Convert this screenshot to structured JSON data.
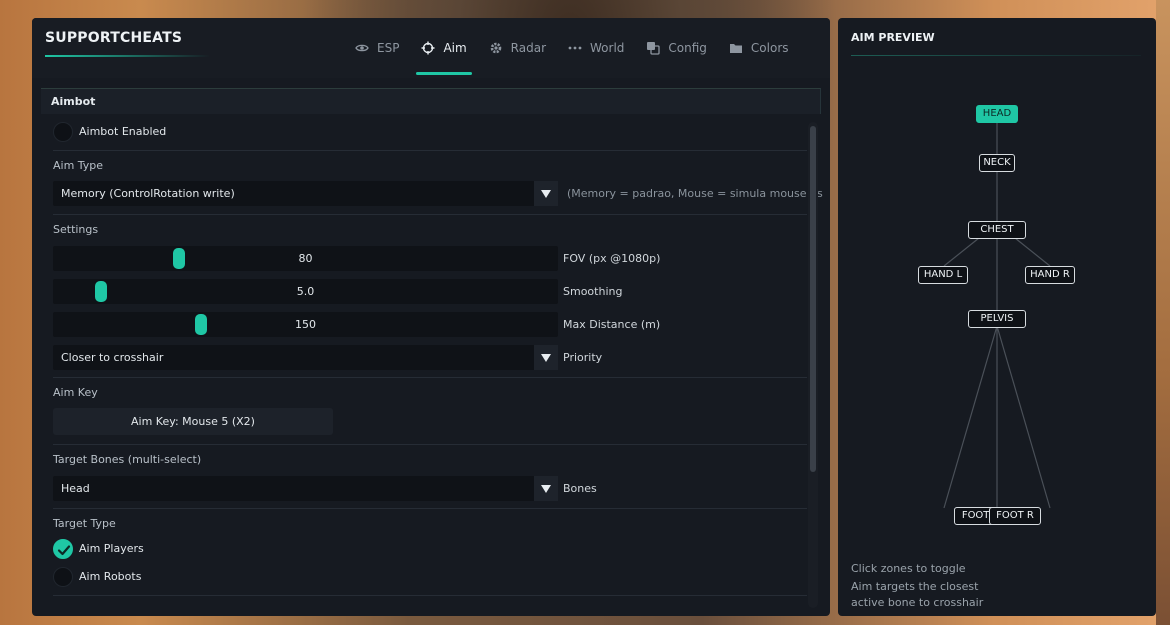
{
  "header": {
    "brand": "SUPPORTCHEATS",
    "tabs": [
      {
        "label": "ESP",
        "icon": "eye-icon",
        "active": false
      },
      {
        "label": "Aim",
        "icon": "crosshair-icon",
        "active": true
      },
      {
        "label": "Radar",
        "icon": "gear-icon",
        "active": false
      },
      {
        "label": "World",
        "icon": "dots-icon",
        "active": false
      },
      {
        "label": "Config",
        "icon": "copy-icon",
        "active": false
      },
      {
        "label": "Colors",
        "icon": "folder-icon",
        "active": false
      }
    ]
  },
  "aimbot": {
    "section_title": "Aimbot",
    "enabled_label": "Aimbot Enabled",
    "enabled": false,
    "aim_type_label": "Aim Type",
    "aim_type_value": "Memory (ControlRotation write)",
    "aim_type_hint": "(Memory = padrao, Mouse = simula mouse fis",
    "settings_label": "Settings",
    "sliders": [
      {
        "value": "80",
        "label": "FOV (px @1080p)",
        "fraction": 0.25
      },
      {
        "value": "5.0",
        "label": "Smoothing",
        "fraction": 0.095
      },
      {
        "value": "150",
        "label": "Max Distance (m)",
        "fraction": 0.293
      }
    ],
    "priority_value": "Closer to crosshair",
    "priority_label": "Priority",
    "aim_key_label": "Aim Key",
    "aim_key_value": "Aim Key: Mouse 5 (X2)",
    "target_bones_label": "Target Bones (multi-select)",
    "target_bones_value": "Head",
    "bones_label": "Bones",
    "target_type_label": "Target Type",
    "aim_players_label": "Aim Players",
    "aim_players": true,
    "aim_robots_label": "Aim Robots",
    "aim_robots": false
  },
  "preview": {
    "title": "AIM PREVIEW",
    "bones": {
      "head": "HEAD",
      "neck": "NECK",
      "chest": "CHEST",
      "hand_l": "HAND L",
      "hand_r": "HAND R",
      "pelvis": "PELVIS",
      "foot_l": "FOOT L",
      "foot_r": "FOOT R"
    },
    "active_bone": "head",
    "note_1": "Click zones to toggle",
    "note_2": "Aim targets the closest",
    "note_3": "active bone to crosshair"
  },
  "colors": {
    "accent": "#1fc7a5",
    "panel": "#161a21"
  }
}
